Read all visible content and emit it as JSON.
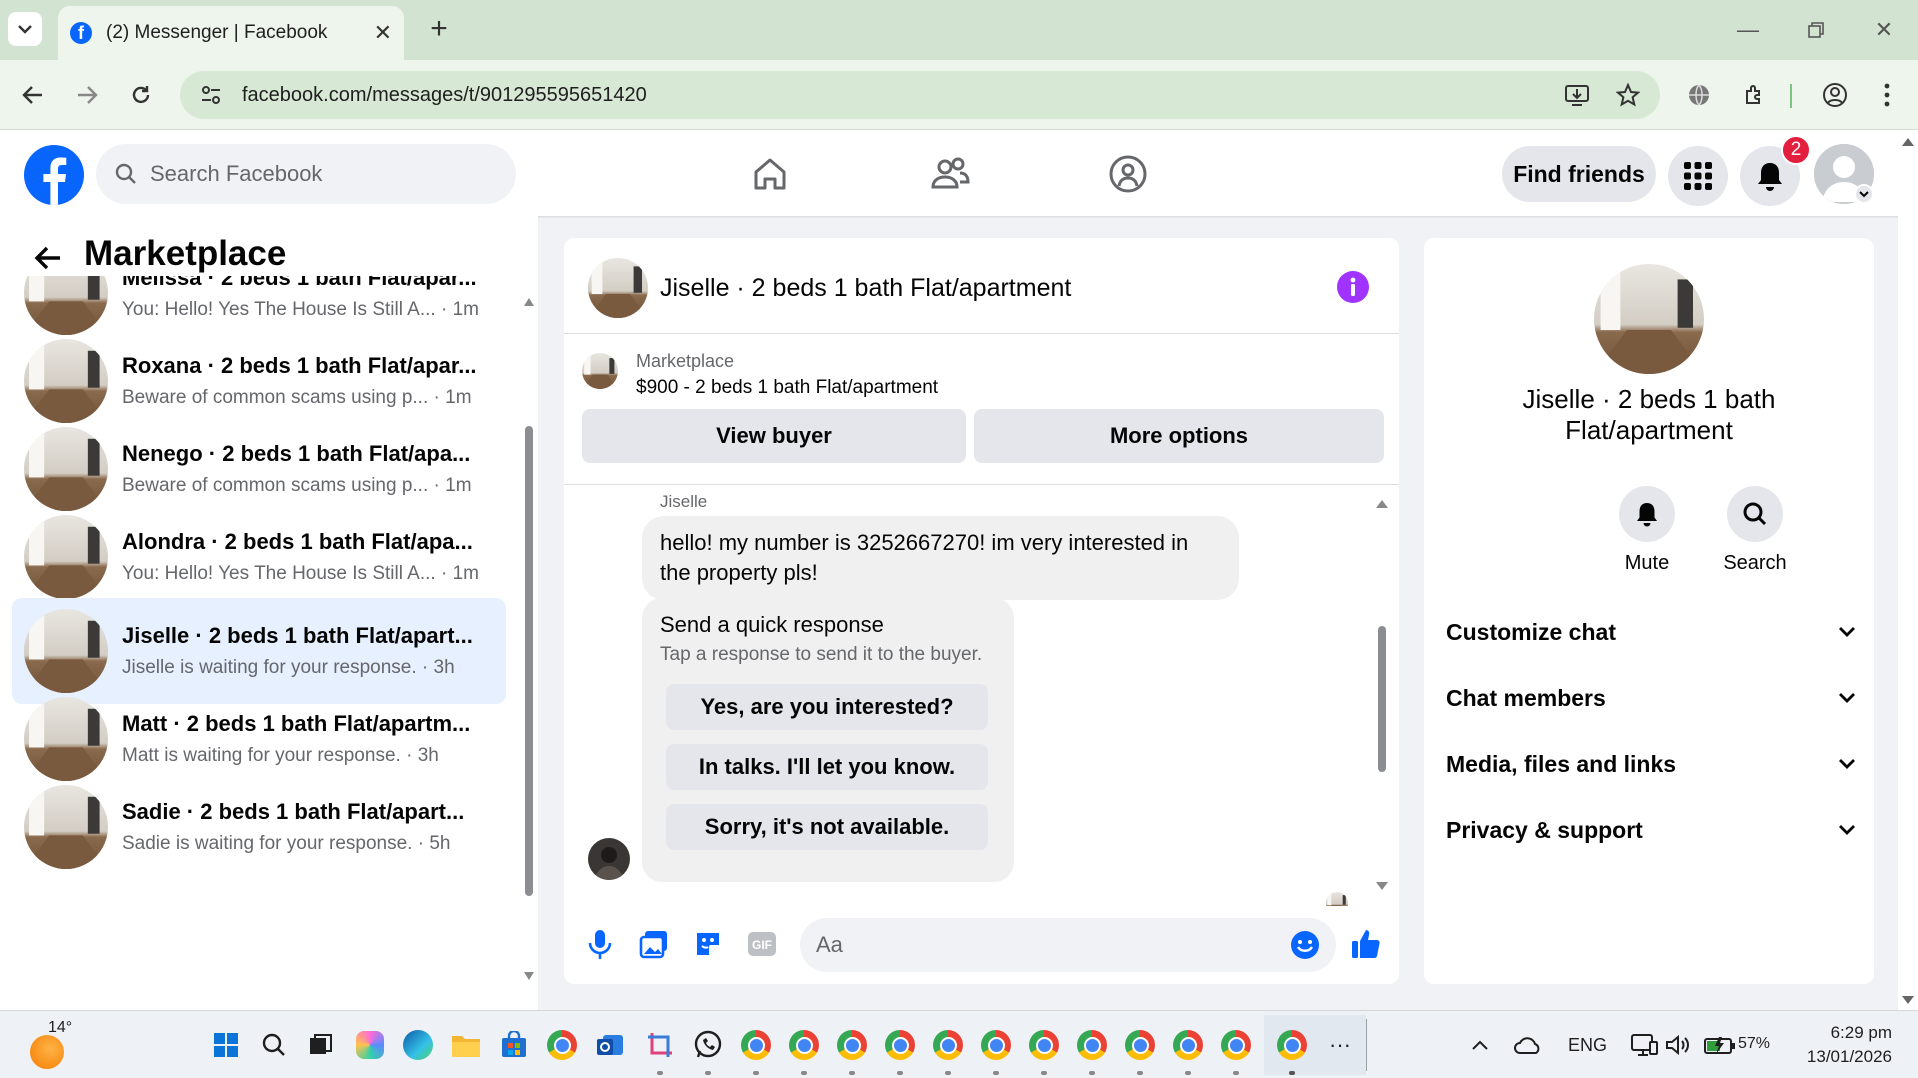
{
  "browser": {
    "tab_title": "(2) Messenger | Facebook",
    "url": "facebook.com/messages/t/901295595651420"
  },
  "header": {
    "search_placeholder": "Search Facebook",
    "find_friends": "Find friends",
    "notifications_count": "2"
  },
  "sidebar": {
    "title": "Marketplace",
    "conversations": [
      {
        "name": "Melissa · 2 beds 1 bath Flat/apar...",
        "preview": "You: Hello! Yes The House Is Still A...",
        "time": "1m",
        "active": false
      },
      {
        "name": "Roxana · 2 beds 1 bath Flat/apar...",
        "preview": "Beware of common scams using p...",
        "time": "1m",
        "active": false
      },
      {
        "name": "Nenego · 2 beds 1 bath Flat/apa...",
        "preview": "Beware of common scams using p...",
        "time": "1m",
        "active": false
      },
      {
        "name": "Alondra · 2 beds 1 bath Flat/apa...",
        "preview": "You: Hello! Yes The House Is Still A...",
        "time": "1m",
        "active": false
      },
      {
        "name": "Jiselle · 2 beds 1 bath Flat/apart...",
        "preview": "Jiselle is waiting for your response.",
        "time": "3h",
        "active": true
      },
      {
        "name": "Matt · 2 beds 1 bath Flat/apartm...",
        "preview": "Matt is waiting for your response.",
        "time": "3h",
        "active": false
      },
      {
        "name": "Sadie · 2 beds 1 bath Flat/apart...",
        "preview": "Sadie is waiting for your response.",
        "time": "5h",
        "active": false
      }
    ]
  },
  "chat": {
    "title": "Jiselle · 2 beds 1 bath Flat/apartment",
    "marketplace_label": "Marketplace",
    "listing": "$900 - 2 beds 1 bath Flat/apartment",
    "view_buyer": "View buyer",
    "more_options": "More options",
    "sender": "Jiselle",
    "message": "hello! my number is 3252667270! im very interested in the property pls!",
    "quick_title": "Send a quick response",
    "quick_sub": "Tap a response to send it to the buyer.",
    "quick_responses": [
      "Yes, are you interested?",
      "In talks. I'll let you know.",
      "Sorry, it's not available."
    ],
    "composer_placeholder": "Aa"
  },
  "details": {
    "name": "Jiselle · 2 beds 1 bath Flat/apartment",
    "mute": "Mute",
    "search": "Search",
    "sections": [
      "Customize chat",
      "Chat members",
      "Media, files and links",
      "Privacy & support"
    ]
  },
  "taskbar": {
    "temp": "14°",
    "lang": "ENG",
    "battery": "57%",
    "time": "6:29 pm",
    "date": "13/01/2026"
  },
  "colors": {
    "fb_blue": "#0866ff",
    "active_row": "#e6f0ff",
    "badge_red": "#e41e3f",
    "info_purple": "#a033ff"
  }
}
